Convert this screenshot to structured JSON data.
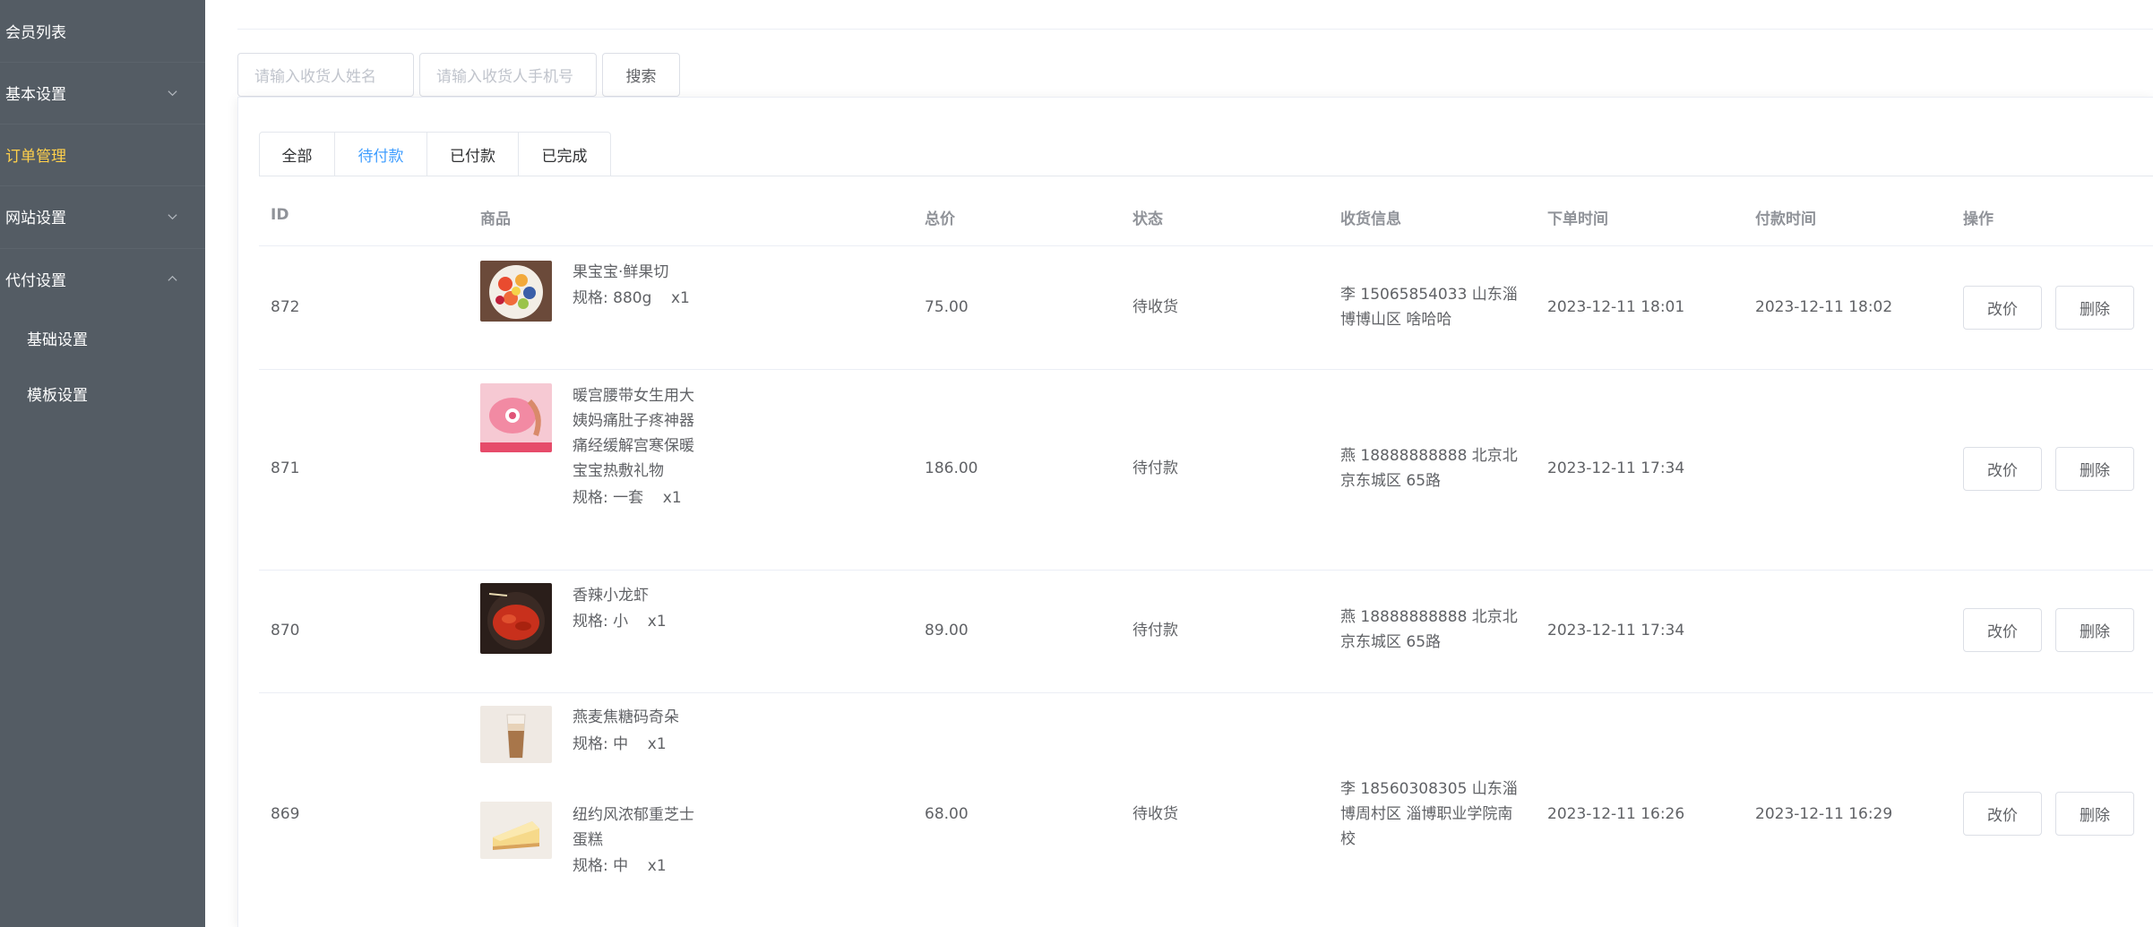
{
  "sidebar": {
    "items": [
      {
        "label": "会员列表"
      },
      {
        "label": "基本设置"
      },
      {
        "label": "订单管理"
      },
      {
        "label": "网站设置"
      },
      {
        "label": "代付设置"
      }
    ],
    "subitems": [
      {
        "label": "基础设置"
      },
      {
        "label": "模板设置"
      }
    ]
  },
  "search": {
    "name_placeholder": "请输入收货人姓名",
    "phone_placeholder": "请输入收货人手机号",
    "button": "搜索"
  },
  "tabs": [
    {
      "label": "全部"
    },
    {
      "label": "待付款"
    },
    {
      "label": "已付款"
    },
    {
      "label": "已完成"
    }
  ],
  "table": {
    "headers": [
      "ID",
      "商品",
      "总价",
      "状态",
      "收货信息",
      "下单时间",
      "付款时间",
      "操作"
    ],
    "ops": {
      "edit_price": "改价",
      "delete": "删除"
    },
    "rows": [
      {
        "id": "872",
        "goods": [
          {
            "name": "果宝宝·鲜果切",
            "spec": "规格: 880g",
            "qty": "x1"
          }
        ],
        "total": "75.00",
        "status": "待收货",
        "address": "李 15065854033 山东淄博博山区 啥哈哈",
        "order_time": "2023-12-11 18:01",
        "pay_time": "2023-12-11 18:02"
      },
      {
        "id": "871",
        "goods": [
          {
            "name": "暖宫腰带女生用大姨妈痛肚子疼神器痛经缓解宫寒保暖宝宝热敷礼物",
            "spec": "规格: 一套",
            "qty": "x1"
          }
        ],
        "total": "186.00",
        "status": "待付款",
        "address": "燕 18888888888 北京北京东城区 65路",
        "order_time": "2023-12-11 17:34",
        "pay_time": ""
      },
      {
        "id": "870",
        "goods": [
          {
            "name": "香辣小龙虾",
            "spec": "规格: 小",
            "qty": "x1"
          }
        ],
        "total": "89.00",
        "status": "待付款",
        "address": "燕 18888888888 北京北京东城区 65路",
        "order_time": "2023-12-11 17:34",
        "pay_time": ""
      },
      {
        "id": "869",
        "goods": [
          {
            "name": "燕麦焦糖码奇朵",
            "spec": "规格: 中",
            "qty": "x1"
          },
          {
            "name": "纽约风浓郁重芝士蛋糕",
            "spec": "规格: 中",
            "qty": "x1"
          }
        ],
        "total": "68.00",
        "status": "待收货",
        "address": "李 18560308305 山东淄博周村区 淄博职业学院南校",
        "order_time": "2023-12-11 16:26",
        "pay_time": "2023-12-11 16:29"
      }
    ]
  },
  "colors": {
    "sidebar_bg": "#545c64",
    "active_menu": "#ffd04b",
    "active_tab": "#409eff"
  }
}
